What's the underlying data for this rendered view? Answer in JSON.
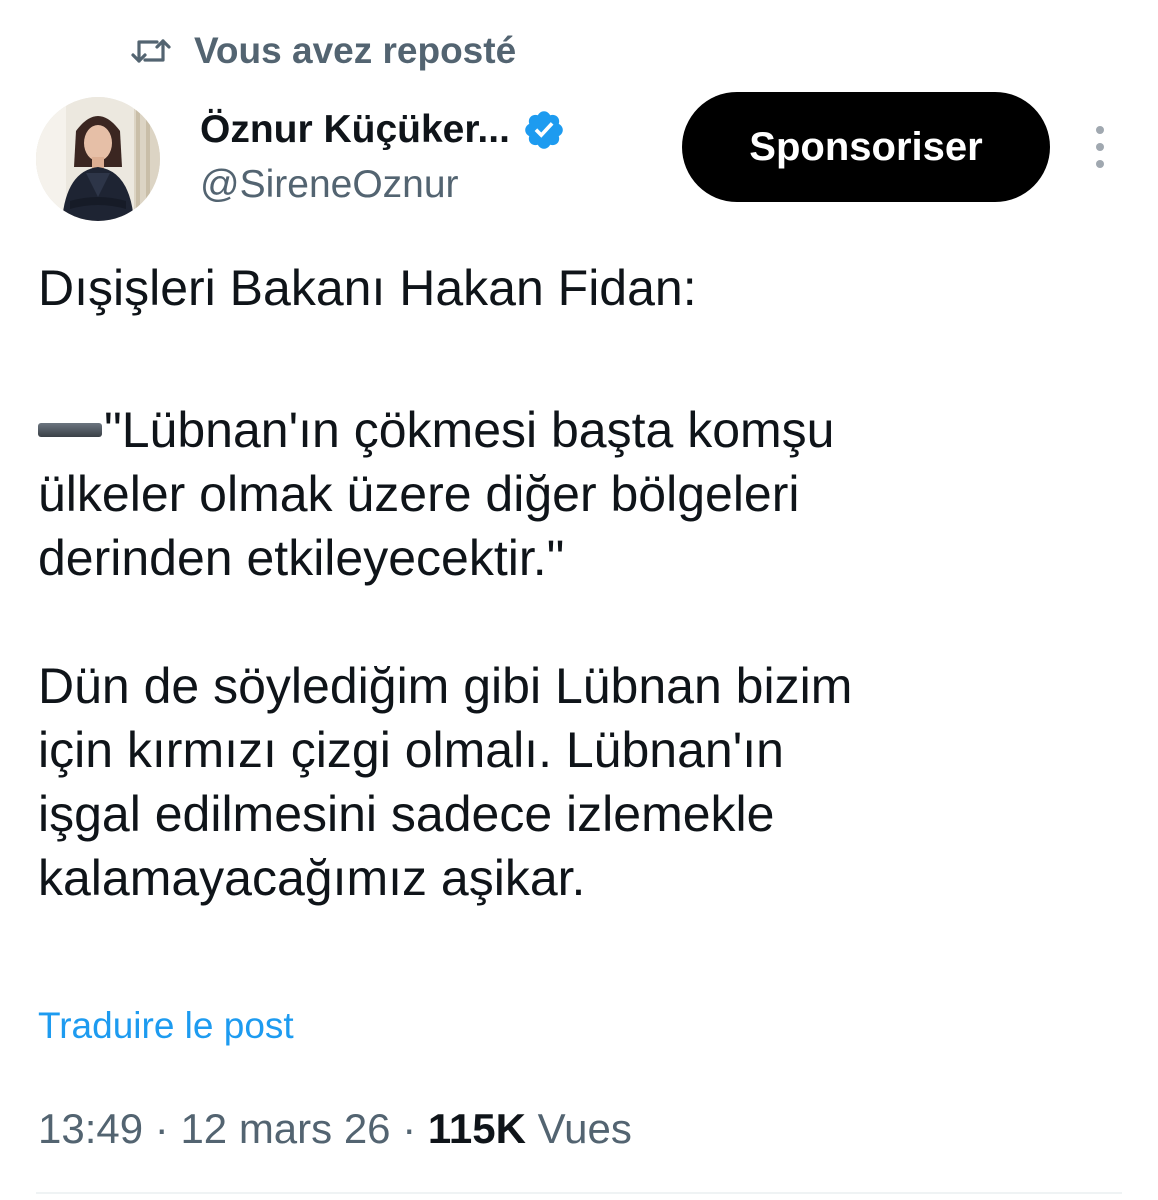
{
  "repost": {
    "label": "Vous avez reposté",
    "icon": "repost-icon"
  },
  "author": {
    "display_name": "Öznur Küçüker...",
    "handle": "@SireneOznur",
    "verified": true,
    "verified_color": "#1d9bf0"
  },
  "actions": {
    "sponsor_label": "Sponsoriser",
    "more_icon": "more-vertical-icon"
  },
  "post": {
    "intro": "Dışişleri Bakanı Hakan Fidan:",
    "quote_icon": "black-dash-emoji",
    "quote_lines": [
      "\"Lübnan'ın çökmesi başta komşu",
      "ülkeler olmak üzere diğer bölgeleri",
      "derinden etkileyecektir.\""
    ],
    "comment_lines": [
      "Dün de söylediğim gibi Lübnan bizim",
      "için kırmızı çizgi olmalı. Lübnan'ın",
      "işgal edilmesini sadece izlemekle",
      "kalamayacağımız aşikar."
    ]
  },
  "translate_label": "Traduire le post",
  "meta": {
    "time": "13:49",
    "separator": " · ",
    "date": "12 mars 26",
    "views_count": "115K",
    "views_label": "Vues"
  },
  "colors": {
    "accent": "#1d9bf0",
    "secondary_text": "#536471",
    "primary_text": "#0f1419",
    "button_bg": "#000000"
  }
}
